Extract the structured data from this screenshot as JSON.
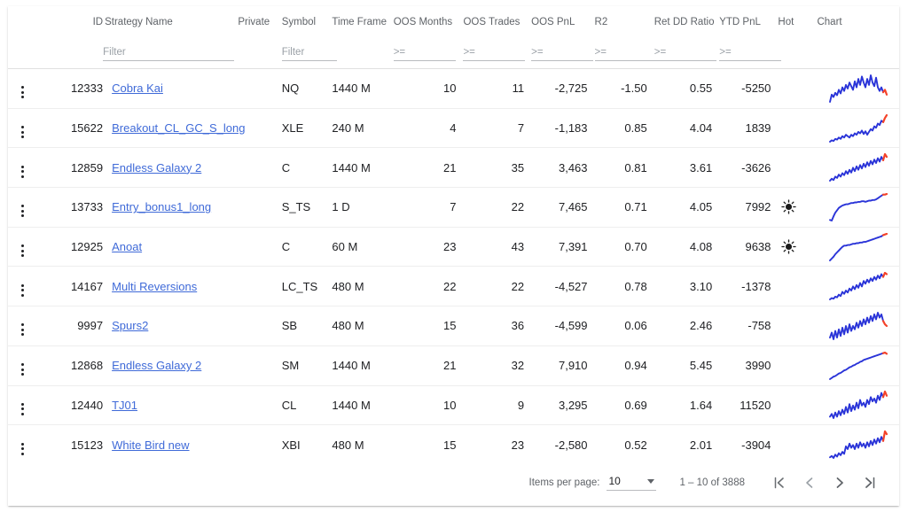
{
  "table": {
    "columns": [
      {
        "key": "menu",
        "label": "",
        "align": "left"
      },
      {
        "key": "id",
        "label": "ID",
        "align": "right"
      },
      {
        "key": "strategy",
        "label": "Strategy Name",
        "align": "left"
      },
      {
        "key": "private",
        "label": "Private",
        "align": "left"
      },
      {
        "key": "symbol",
        "label": "Symbol",
        "align": "left"
      },
      {
        "key": "time_frame",
        "label": "Time Frame",
        "align": "left"
      },
      {
        "key": "oos_months",
        "label": "OOS Months",
        "align": "right"
      },
      {
        "key": "oos_trades",
        "label": "OOS Trades",
        "align": "right"
      },
      {
        "key": "oos_pnl",
        "label": "OOS PnL",
        "align": "right"
      },
      {
        "key": "r2",
        "label": "R2",
        "align": "right"
      },
      {
        "key": "ret_dd",
        "label": "Ret DD Ratio",
        "align": "right"
      },
      {
        "key": "ytd_pnl",
        "label": "YTD PnL",
        "align": "right"
      },
      {
        "key": "hot",
        "label": "Hot",
        "align": "left"
      },
      {
        "key": "chart",
        "label": "Chart",
        "align": "left"
      }
    ],
    "filters": {
      "strategy_placeholder": "Filter",
      "symbol_placeholder": "Filter",
      "oos_months_placeholder": ">=",
      "oos_trades_placeholder": ">=",
      "oos_pnl_placeholder": ">=",
      "r2_placeholder": ">=",
      "ret_dd_placeholder": ">=",
      "ytd_pnl_placeholder": ">=",
      "strategy_value": "",
      "symbol_value": "",
      "oos_months_value": "",
      "oos_trades_value": "",
      "oos_pnl_value": "",
      "r2_value": "",
      "ret_dd_value": "",
      "ytd_pnl_value": ""
    },
    "rows": [
      {
        "id": "12333",
        "strategy": "Cobra Kai",
        "private": "",
        "symbol": "NQ",
        "time_frame": "1440 M",
        "oos_months": "10",
        "oos_trades": "11",
        "oos_pnl": "-2,725",
        "oos_pnl_negative": true,
        "r2": "-1.50",
        "ret_dd": "0.55",
        "ytd_pnl": "-5250",
        "ytd_pnl_negative": true,
        "hot": false,
        "spark": [
          2,
          14,
          10,
          17,
          13,
          22,
          16,
          26,
          20,
          30,
          24,
          34,
          28,
          22,
          36,
          26,
          40,
          30,
          44,
          34,
          26,
          40,
          30,
          46,
          34,
          28,
          42,
          26,
          20,
          26,
          18,
          22,
          14
        ]
      },
      {
        "id": "15622",
        "strategy": "Breakout_CL_GC_S_long",
        "private": "",
        "symbol": "XLE",
        "time_frame": "240 M",
        "oos_months": "4",
        "oos_trades": "7",
        "oos_pnl": "-1,183",
        "oos_pnl_negative": true,
        "r2": "0.85",
        "ret_dd": "4.04",
        "ytd_pnl": "1839",
        "ytd_pnl_negative": false,
        "hot": false,
        "spark": [
          4,
          6,
          5,
          8,
          7,
          10,
          8,
          12,
          10,
          14,
          12,
          10,
          14,
          12,
          16,
          14,
          18,
          16,
          20,
          15,
          19,
          14,
          18,
          22,
          20,
          26,
          24,
          30,
          28,
          34,
          32,
          38,
          42
        ]
      },
      {
        "id": "12859",
        "strategy": "Endless Galaxy 2",
        "private": "",
        "symbol": "C",
        "time_frame": "1440 M",
        "oos_months": "21",
        "oos_trades": "35",
        "oos_pnl": "3,463",
        "oos_pnl_negative": false,
        "r2": "0.81",
        "ret_dd": "3.61",
        "ytd_pnl": "-3626",
        "ytd_pnl_negative": true,
        "hot": false,
        "spark": [
          3,
          6,
          4,
          9,
          7,
          12,
          9,
          14,
          11,
          17,
          13,
          19,
          15,
          22,
          17,
          24,
          19,
          26,
          21,
          28,
          23,
          30,
          25,
          32,
          27,
          34,
          29,
          36,
          31,
          38,
          33,
          42,
          38
        ]
      },
      {
        "id": "13733",
        "strategy": "Entry_bonus1_long",
        "private": "",
        "symbol": "S_TS",
        "time_frame": "1 D",
        "oos_months": "7",
        "oos_trades": "22",
        "oos_pnl": "7,465",
        "oos_pnl_negative": false,
        "r2": "0.71",
        "ret_dd": "4.05",
        "ytd_pnl": "7992",
        "ytd_pnl_negative": false,
        "hot": true,
        "spark": [
          2,
          1,
          8,
          14,
          18,
          22,
          24,
          26,
          27,
          28,
          28,
          29,
          30,
          30,
          31,
          31,
          32,
          32,
          33,
          33,
          32,
          33,
          34,
          34,
          35,
          35,
          36,
          38,
          40,
          42,
          44,
          44,
          45
        ]
      },
      {
        "id": "12925",
        "strategy": "Anoat",
        "private": "",
        "symbol": "C",
        "time_frame": "60 M",
        "oos_months": "23",
        "oos_trades": "43",
        "oos_pnl": "7,391",
        "oos_pnl_negative": false,
        "r2": "0.70",
        "ret_dd": "4.08",
        "ytd_pnl": "9638",
        "ytd_pnl_negative": false,
        "hot": true,
        "spark": [
          2,
          5,
          8,
          12,
          15,
          18,
          21,
          24,
          26,
          26,
          27,
          27,
          28,
          29,
          29,
          30,
          30,
          31,
          31,
          32,
          32,
          33,
          34,
          35,
          36,
          37,
          38,
          39,
          40,
          41,
          43,
          44,
          45
        ]
      },
      {
        "id": "14167",
        "strategy": "Multi Reversions",
        "private": "",
        "symbol": "LC_TS",
        "time_frame": "480 M",
        "oos_months": "22",
        "oos_trades": "22",
        "oos_pnl": "-4,527",
        "oos_pnl_negative": true,
        "r2": "0.78",
        "ret_dd": "3.10",
        "ytd_pnl": "-1378",
        "ytd_pnl_negative": true,
        "hot": false,
        "spark": [
          3,
          5,
          4,
          7,
          6,
          10,
          8,
          14,
          11,
          16,
          13,
          19,
          16,
          22,
          18,
          24,
          20,
          27,
          22,
          30,
          26,
          32,
          28,
          34,
          30,
          36,
          32,
          38,
          34,
          40,
          36,
          42,
          40
        ]
      },
      {
        "id": "9997",
        "strategy": "Spurs2",
        "private": "",
        "symbol": "SB",
        "time_frame": "480 M",
        "oos_months": "15",
        "oos_trades": "36",
        "oos_pnl": "-4,599",
        "oos_pnl_negative": true,
        "r2": "0.06",
        "ret_dd": "2.46",
        "ytd_pnl": "-758",
        "ytd_pnl_negative": true,
        "hot": false,
        "spark": [
          14,
          20,
          12,
          22,
          14,
          24,
          16,
          26,
          18,
          28,
          20,
          30,
          22,
          28,
          24,
          32,
          26,
          34,
          28,
          36,
          30,
          38,
          32,
          40,
          34,
          42,
          36,
          44,
          38,
          42,
          34,
          30,
          28
        ]
      },
      {
        "id": "12868",
        "strategy": "Endless Galaxy 2",
        "private": "",
        "symbol": "SM",
        "time_frame": "1440 M",
        "oos_months": "21",
        "oos_trades": "32",
        "oos_pnl": "7,910",
        "oos_pnl_negative": false,
        "r2": "0.94",
        "ret_dd": "5.45",
        "ytd_pnl": "3990",
        "ytd_pnl_negative": false,
        "hot": false,
        "spark": [
          2,
          4,
          6,
          7,
          9,
          11,
          12,
          14,
          16,
          17,
          19,
          21,
          22,
          24,
          25,
          27,
          28,
          30,
          31,
          33,
          34,
          35,
          36,
          37,
          38,
          39,
          40,
          41,
          42,
          43,
          44,
          45,
          43
        ]
      },
      {
        "id": "12440",
        "strategy": "TJ01",
        "private": "",
        "symbol": "CL",
        "time_frame": "1440 M",
        "oos_months": "10",
        "oos_trades": "9",
        "oos_pnl": "3,295",
        "oos_pnl_negative": false,
        "r2": "0.69",
        "ret_dd": "1.64",
        "ytd_pnl": "11520",
        "ytd_pnl_negative": false,
        "hot": false,
        "spark": [
          10,
          14,
          8,
          16,
          10,
          18,
          12,
          20,
          14,
          24,
          16,
          28,
          18,
          26,
          20,
          30,
          22,
          34,
          26,
          30,
          24,
          34,
          28,
          38,
          32,
          36,
          30,
          40,
          34,
          44,
          38,
          46,
          40
        ]
      },
      {
        "id": "15123",
        "strategy": "White Bird new",
        "private": "",
        "symbol": "XBI",
        "time_frame": "480 M",
        "oos_months": "15",
        "oos_trades": "23",
        "oos_pnl": "-2,580",
        "oos_pnl_negative": true,
        "r2": "0.52",
        "ret_dd": "2.01",
        "ytd_pnl": "-3904",
        "ytd_pnl_negative": true,
        "hot": false,
        "spark": [
          6,
          8,
          5,
          10,
          7,
          12,
          9,
          14,
          11,
          22,
          18,
          26,
          20,
          24,
          18,
          26,
          20,
          28,
          22,
          26,
          20,
          28,
          22,
          30,
          24,
          32,
          26,
          34,
          28,
          36,
          30,
          44,
          40
        ]
      }
    ]
  },
  "paginator": {
    "items_per_page_label": "Items per page:",
    "page_size": "10",
    "range_label": "1 – 10 of 3888",
    "first_page_title": "First page",
    "prev_page_title": "Previous page",
    "next_page_title": "Next page",
    "last_page_title": "Last page"
  },
  "colors": {
    "link": "#3f6ad8",
    "negative": "#f44336",
    "spark_line": "#2a34d8",
    "spark_tip": "#f4432a",
    "header_text": "#5f6368",
    "body_text": "#202124"
  }
}
